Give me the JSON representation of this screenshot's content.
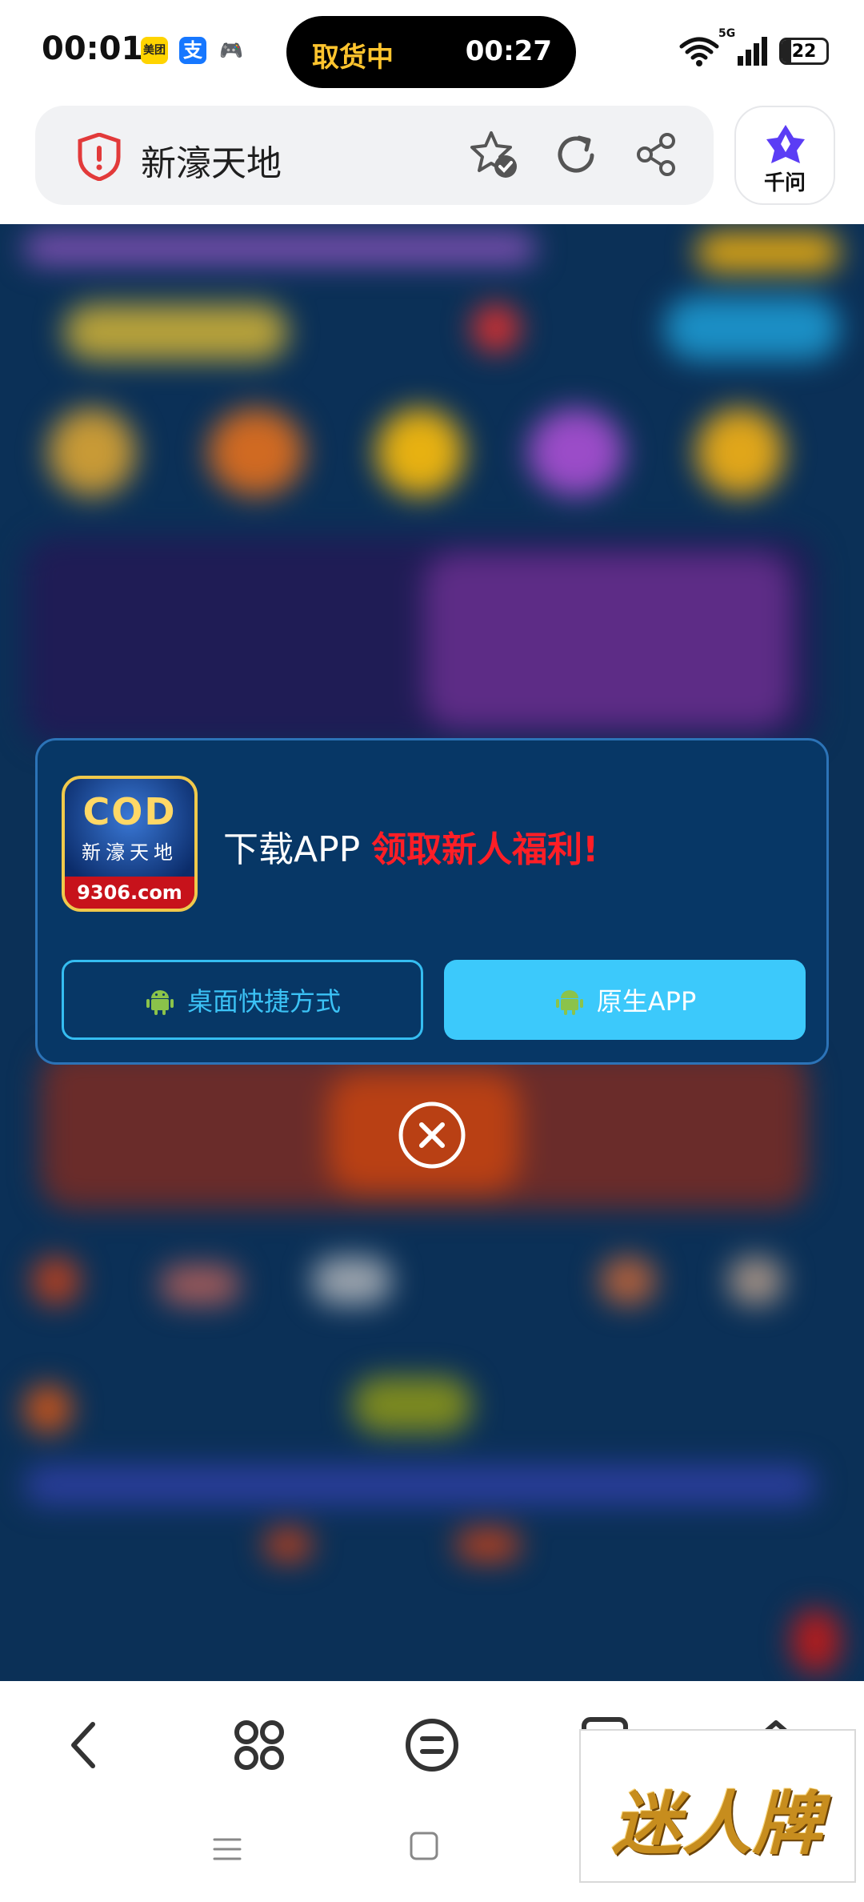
{
  "status_bar": {
    "time": "00:01",
    "apps": [
      {
        "name": "meituan-icon",
        "label": "美团"
      },
      {
        "name": "alipay-icon",
        "label": "支"
      },
      {
        "name": "game-icon",
        "label": "🎮"
      }
    ],
    "live_activity": {
      "label": "取货中",
      "timer": "00:27"
    },
    "network": "5G",
    "battery_level": "22",
    "battery_fraction": 0.22
  },
  "browser": {
    "page_title": "新濠天地",
    "assistant_label": "千问"
  },
  "modal": {
    "app_icon": {
      "logo": "COD",
      "name": "新濠天地",
      "url": "9306.com"
    },
    "headline": "下载APP ",
    "headline_promo": "领取新人福利!",
    "buttons": {
      "shortcut": "桌面快捷方式",
      "native": "原生APP"
    }
  },
  "watermark": "迷人牌",
  "colors": {
    "modal_bg": "#073766",
    "accent_cyan": "#3cc9fb",
    "promo_red": "#ff1e26",
    "page_bg": "#0b3057"
  }
}
